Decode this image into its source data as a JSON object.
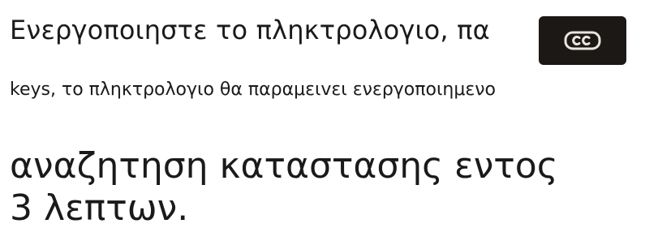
{
  "caption": {
    "line_1": "Ενεργοποιηστε το πληκτρολογιο, πα",
    "line_2": "keys, το πληκτρολογιο θα παραμειvει ενεργοποιημενο",
    "line_3": "αναζητηση καταστασης εντος",
    "line_4": "3 λεπτων."
  },
  "overlay": {
    "icon": "closed-captions-icon",
    "background": "#1c1816"
  }
}
